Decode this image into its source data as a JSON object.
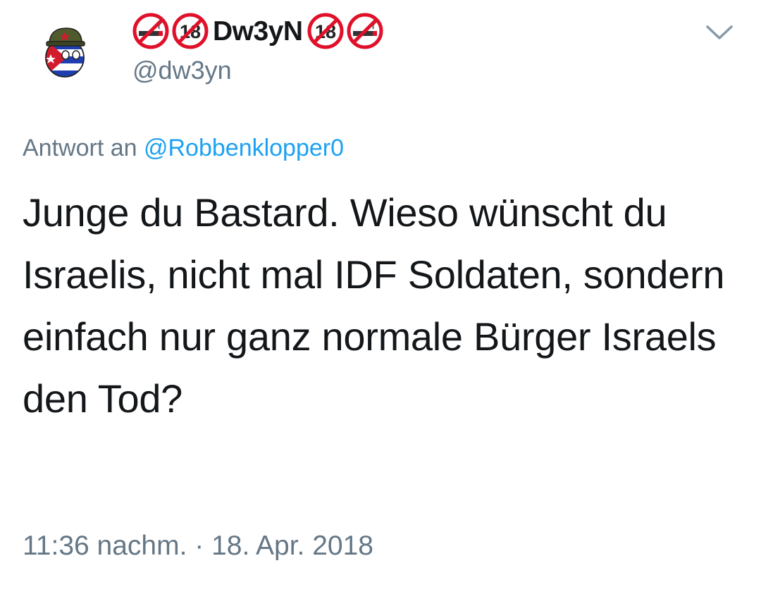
{
  "user": {
    "display_name": "Dw3yN",
    "handle": "@dw3yn",
    "avatar_icon": "cuba-countryball-avatar-icon",
    "badges_left": [
      "no-smoking-icon",
      "eighteen-plus-icon"
    ],
    "badges_right": [
      "eighteen-plus-icon",
      "no-smoking-icon"
    ]
  },
  "menu": {
    "icon": "chevron-down-icon"
  },
  "reply": {
    "prefix": "Antwort an",
    "mention": "@Robbenklopper0"
  },
  "tweet": {
    "text": "Junge du Bastard. Wieso wünscht du Israelis, nicht mal IDF Soldaten, sondern einfach nur ganz normale Bürger Israels den Tod?"
  },
  "meta": {
    "timestamp": "11:36 nachm. · 18. Apr. 2018"
  },
  "colors": {
    "text": "#14171a",
    "secondary": "#657786",
    "link": "#1da1f2",
    "badge_red": "#e0102a"
  }
}
